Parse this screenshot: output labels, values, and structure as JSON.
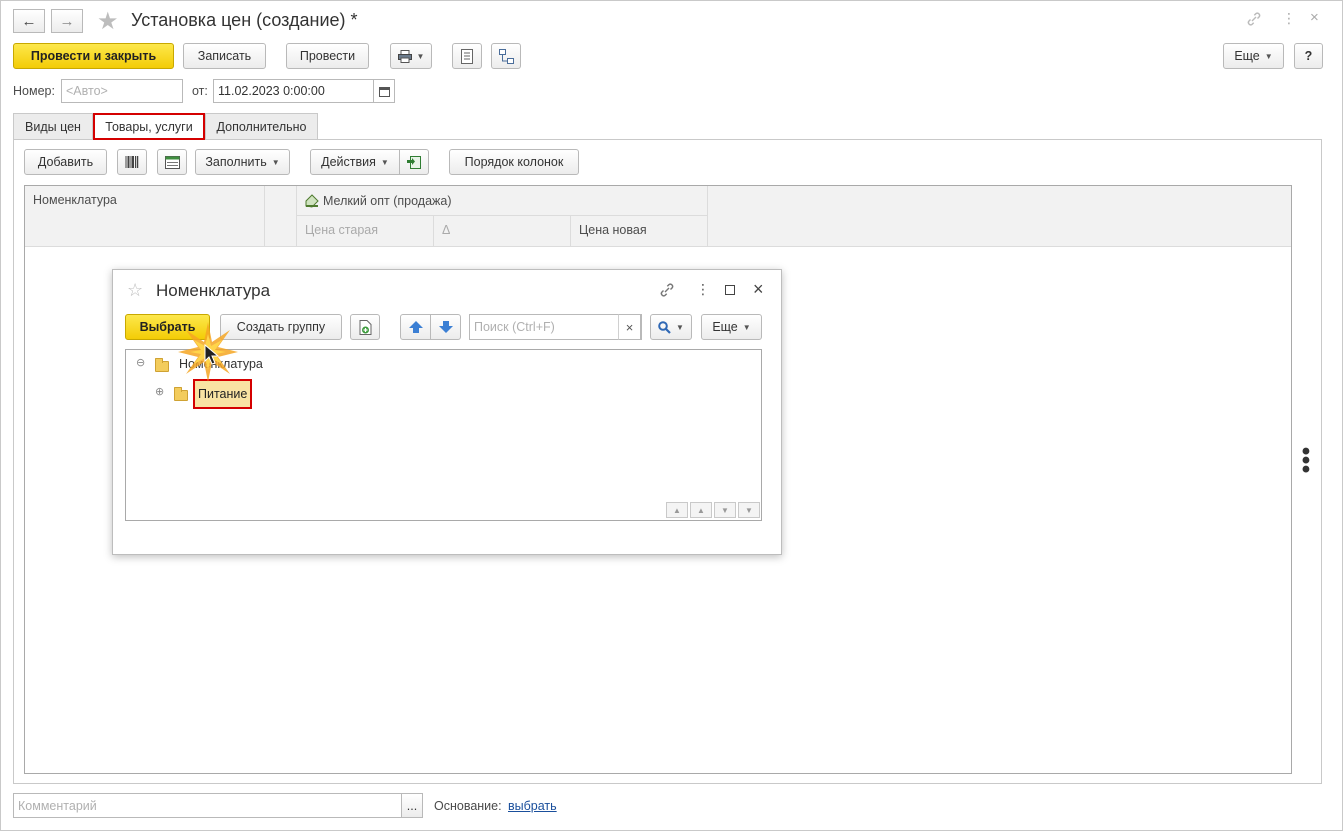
{
  "window": {
    "title": "Установка цен (создание) *",
    "back_icon": "arrow-left-icon",
    "forward_icon": "arrow-right-icon",
    "favorite_icon": "star-icon",
    "link_icon": "link-icon",
    "menu_icon": "more-vertical-icon",
    "close_icon": "close-icon"
  },
  "toolbar": {
    "post_close": "Провести и закрыть",
    "save": "Записать",
    "post": "Провести",
    "more": "Еще",
    "help": "?"
  },
  "header": {
    "number_label": "Номер:",
    "number_placeholder": "<Авто>",
    "date_label": "от:",
    "date_value": "11.02.2023  0:00:00"
  },
  "tabs": [
    {
      "label": "Виды цен"
    },
    {
      "label": "Товары, услуги"
    },
    {
      "label": "Дополнительно"
    }
  ],
  "table_toolbar": {
    "add": "Добавить",
    "fill": "Заполнить",
    "actions": "Действия",
    "column_order": "Порядок колонок"
  },
  "grid": {
    "col_nomenclature": "Номенклатура",
    "price_group": "Мелкий опт (продажа)",
    "col_old_price": "Цена старая",
    "col_delta": "Δ",
    "col_new_price": "Цена новая"
  },
  "dialog": {
    "title": "Номенклатура",
    "select": "Выбрать",
    "create_group": "Создать группу",
    "search_placeholder": "Поиск (Ctrl+F)",
    "search_clear": "×",
    "more": "Еще",
    "tree": [
      {
        "label": "Номенклатура",
        "expander": "⊖"
      },
      {
        "label": "Питание",
        "expander": "⊕"
      }
    ]
  },
  "footer": {
    "comment_placeholder": "Комментарий",
    "comment_btn": "...",
    "basis_label": "Основание:",
    "basis_link": "выбрать"
  },
  "colors": {
    "accent_yellow": "#f3cc06",
    "highlight_red": "#d40000",
    "link_blue": "#1a4f9c"
  }
}
